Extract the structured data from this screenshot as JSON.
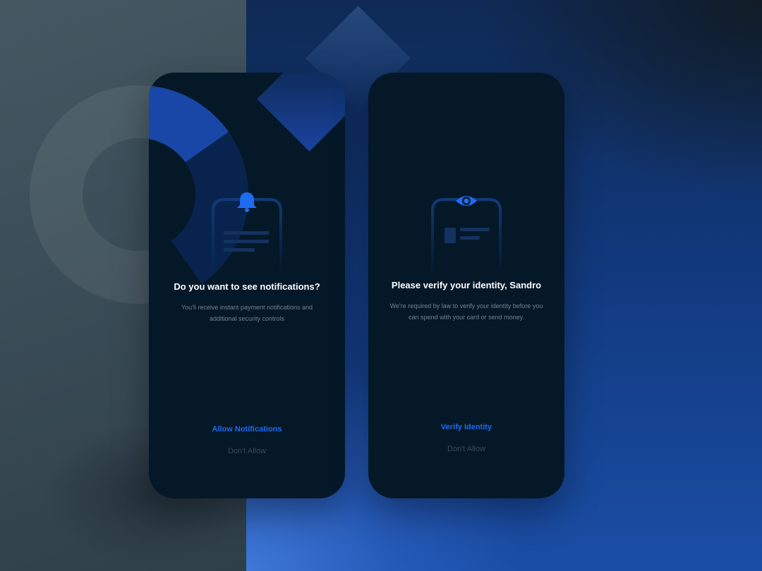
{
  "screens": [
    {
      "title": "Do you want to see notifications?",
      "description": "You'll receive instant payment notifications and additional security controls",
      "primary_action": "Allow Notifications",
      "secondary_action": "Don't Allow",
      "icon": "bell-icon"
    },
    {
      "title": "Please verify your identity, Sandro",
      "description": "We're required by law to verify your identity before you can spend with your card or send money.",
      "primary_action": "Verify Identity",
      "secondary_action": "Don't Allow",
      "icon": "eye-icon"
    }
  ],
  "colors": {
    "accent": "#1e6cf0",
    "card_background": "#041828",
    "muted_text": "#6f8596",
    "disabled_text": "#3a4c5a"
  }
}
